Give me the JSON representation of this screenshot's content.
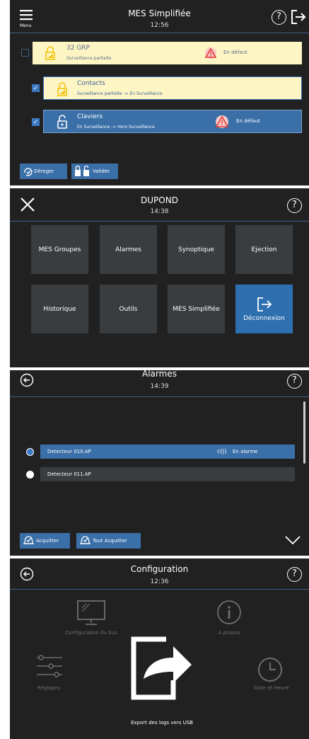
{
  "screen1": {
    "title": "MES Simplifiée",
    "time": "12:56",
    "menu_label": "Menu",
    "rows": [
      {
        "name": "32 GRP",
        "sub": "Surveillance partielle",
        "status": "En défaut"
      },
      {
        "name": "Contacts",
        "sub": "Surveillance partielle -> En Surveillance",
        "status": ""
      },
      {
        "name": "Claviers",
        "sub": "En Surveillance -> Hors Surveillance",
        "status": "En défaut"
      }
    ],
    "buttons": {
      "derog": "Déroger",
      "valider": "Valider"
    }
  },
  "screen2": {
    "title": "DUPOND",
    "time": "14:38",
    "tiles": [
      "MES Groupes",
      "Alarmes",
      "Synoptique",
      "Ejection",
      "Historique",
      "Outils",
      "MES Simplifiée",
      "Déconnexion"
    ]
  },
  "screen3": {
    "title": "Alarmes",
    "time": "14:39",
    "alarms": [
      {
        "name": "Detecteur 010.AP",
        "status": "En alarme"
      },
      {
        "name": "Detecteur 011.AP",
        "status": ""
      }
    ],
    "buttons": {
      "ack": "Acquitter",
      "ack_all": "Tout Acquitter"
    }
  },
  "screen4": {
    "title": "Configuration",
    "time": "12:36",
    "items": [
      "Configuration du bus",
      "A propos",
      "Réglages",
      "Date et Heure",
      "Export des logs vers USB"
    ]
  },
  "colors": {
    "accent": "#3a6fa8",
    "bg": "#212121",
    "warn": "#e53935",
    "yellow": "#fdf6c4"
  }
}
